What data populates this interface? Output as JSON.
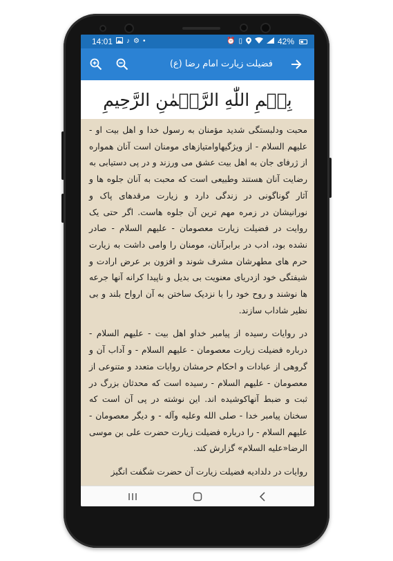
{
  "status_bar": {
    "time": "14:01",
    "battery_percent": "42%",
    "left_icons": [
      "gallery-icon",
      "music-note-icon",
      "settings-icon",
      "dot-icon"
    ],
    "right_icons": [
      "alarm-icon",
      "vibrate-icon",
      "location-icon",
      "wifi-icon",
      "signal-icon",
      "battery-icon"
    ]
  },
  "app_bar": {
    "title": "فضیلت زیارت امام رضا (ع)",
    "color": "#2b82d4"
  },
  "bismillah": "بِسۡمِ اللّٰهِ الرَّحۡمٰنِ الرَّحِیمِ",
  "content": {
    "background": "#e6dbc6",
    "paragraphs": [
      "محبت ودلبستگی شدید مؤمنان به رسول خدا و اهل بیت او - علیهم السلام - از ویژگیهاوامتیازهای مومنان است آنان همواره از ژرفای جان به اهل بیت عشق می ورزند و در پی دستیابی به رضایت آنان هستند وطبیعی است که محبت به آنان جلوه ها و آثار گوناگونی در زندگی دارد و زیارت مرقدهای پاک و نورانیشان در زمره مهم ترین آن جلوه هاست. اگر حتی یک روایت در فضیلت زیارت معصومان - علیهم السلام - صادر نشده بود، ادب در برابرآنان، مومنان را وامی داشت به زیارت حرم های مطهرشان مشرف شوند و افزون بر عرض ارادت و شیفتگی خود ازدریای معنویت بی بدیل و ناپیدا کرانه آنها جرعه ها نوشند و روح خود را با نزدیک ساختن به آن ارواح بلند و بی نظیر شاداب سازند.",
      "در روایات رسیده از پیامبر خداو اهل بیت - علیهم السلام - درباره فضیلت زیارت معصومان - علیهم السلام - و آداب آن و گروهی از عبادات و احکام حرمشان روایات متعدد و متنوعی از معصومان - علیهم السلام - رسیده است که محدثان بزرگ در ثبت و ضبط آنهاکوشیده اند. این نوشته در پی آن است که سخنان پیامبر خدا - صلی الله وعلیه وآله - و دیگر معصومان - علیهم السلام - را درباره فضیلت زیارت حضرت علی بن موسی الرضا«علیه السلام» گزارش کند.",
      "روایات در دلدادیه فضیلت زیارت آن حضرت شگفت انگیز"
    ]
  }
}
